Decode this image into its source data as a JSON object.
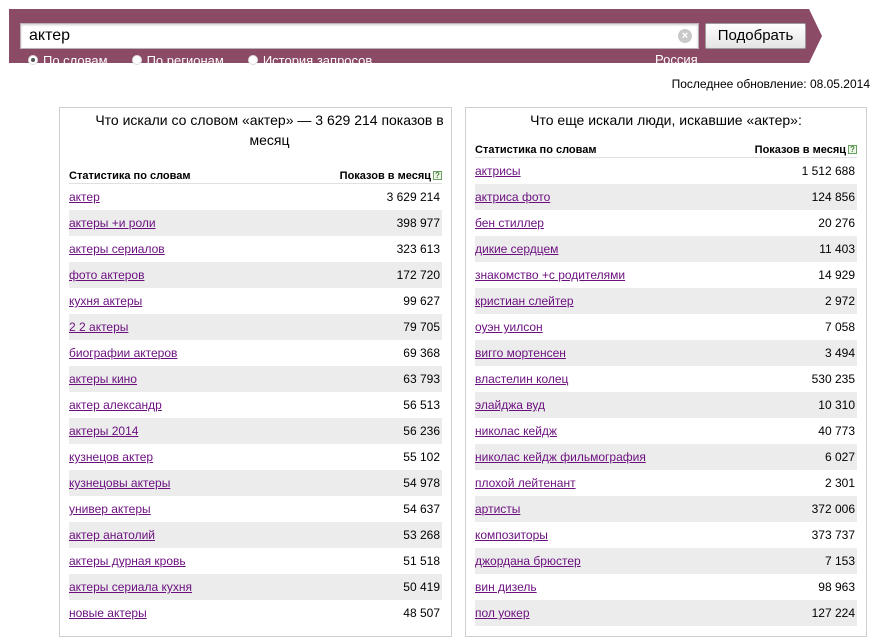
{
  "search": {
    "value": "актер",
    "clear_glyph": "×",
    "submit_label": "Подобрать"
  },
  "modes": [
    {
      "label": "По словам",
      "checked": true
    },
    {
      "label": "По регионам",
      "checked": false
    },
    {
      "label": "История запросов",
      "checked": false
    }
  ],
  "region": "Россия",
  "updated": "Последнее обновление: 08.05.2014",
  "colors": {
    "bar": "#8b4a66",
    "link": "#6b0f7f",
    "stripe": "#ececec"
  },
  "left": {
    "title": "Что искали со словом «актер» — 3 629 214 показов в месяц",
    "col_word": "Статистика по словам",
    "col_count": "Показов в месяц",
    "help": "?",
    "rows": [
      {
        "word": "актер",
        "count": "3 629 214"
      },
      {
        "word": "актеры +и роли",
        "count": "398 977"
      },
      {
        "word": "актеры сериалов",
        "count": "323 613"
      },
      {
        "word": "фото актеров",
        "count": "172 720"
      },
      {
        "word": "кухня актеры",
        "count": "99 627"
      },
      {
        "word": "2 2 актеры",
        "count": "79 705"
      },
      {
        "word": "биографии актеров",
        "count": "69 368"
      },
      {
        "word": "актеры кино",
        "count": "63 793"
      },
      {
        "word": "актер александр",
        "count": "56 513"
      },
      {
        "word": "актеры 2014",
        "count": "56 236"
      },
      {
        "word": "кузнецов актер",
        "count": "55 102"
      },
      {
        "word": "кузнецовы актеры",
        "count": "54 978"
      },
      {
        "word": "универ актеры",
        "count": "54 637"
      },
      {
        "word": "актер анатолий",
        "count": "53 268"
      },
      {
        "word": "актеры дурная кровь",
        "count": "51 518"
      },
      {
        "word": "актеры сериала кухня",
        "count": "50 419"
      },
      {
        "word": "новые актеры",
        "count": "48 507"
      }
    ]
  },
  "right": {
    "title": "Что еще искали люди, искавшие «актер»:",
    "col_word": "Статистика по словам",
    "col_count": "Показов в месяц",
    "help": "?",
    "rows": [
      {
        "word": "актрисы",
        "count": "1 512 688"
      },
      {
        "word": "актриса фото",
        "count": "124 856"
      },
      {
        "word": "бен стиллер",
        "count": "20 276"
      },
      {
        "word": "дикие сердцем",
        "count": "11 403"
      },
      {
        "word": "знакомство +с родителями",
        "count": "14 929"
      },
      {
        "word": "кристиан слейтер",
        "count": "2 972"
      },
      {
        "word": "оуэн уилсон",
        "count": "7 058"
      },
      {
        "word": "вигго мортенсен",
        "count": "3 494"
      },
      {
        "word": "властелин колец",
        "count": "530 235"
      },
      {
        "word": "элайджа вуд",
        "count": "10 310"
      },
      {
        "word": "николас кейдж",
        "count": "40 773"
      },
      {
        "word": "николас кейдж фильмография",
        "count": "6 027"
      },
      {
        "word": "плохой лейтенант",
        "count": "2 301"
      },
      {
        "word": "артисты",
        "count": "372 006"
      },
      {
        "word": "композиторы",
        "count": "373 737"
      },
      {
        "word": "джордана брюстер",
        "count": "7 153"
      },
      {
        "word": "вин дизель",
        "count": "98 963"
      },
      {
        "word": "пол уокер",
        "count": "127 224"
      }
    ]
  }
}
